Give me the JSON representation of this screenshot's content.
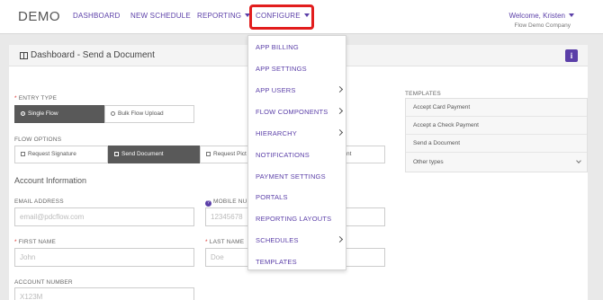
{
  "header": {
    "logo": "DEMO",
    "nav": [
      "DASHBOARD",
      "NEW SCHEDULE",
      "REPORTING",
      "CONFIGURE"
    ],
    "welcome": "Welcome, Kristen",
    "company": "Flow Demo Company"
  },
  "panel": {
    "title": "Dashboard - Send a Document",
    "info_label": "i"
  },
  "entry_type": {
    "label": "ENTRY TYPE",
    "options": [
      "Single Flow",
      "Bulk Flow Upload"
    ],
    "selected": "Single Flow"
  },
  "flow_options": {
    "label": "FLOW OPTIONS",
    "options": [
      "Request Signature",
      "Send Document",
      "Request Pict",
      "nt"
    ],
    "selected": "Send Document"
  },
  "account": {
    "title": "Account Information",
    "email_label": "EMAIL ADDRESS",
    "email_placeholder": "email@pdcflow.com",
    "mobile_label": "MOBILE NUM",
    "mobile_placeholder": "12345678",
    "first_name_label": "FIRST NAME",
    "first_name_placeholder": "John",
    "last_name_label": "LAST NAME",
    "last_name_placeholder": "Doe",
    "account_number_label": "ACCOUNT NUMBER",
    "account_number_placeholder": "X123M"
  },
  "templates": {
    "label": "TEMPLATES",
    "items": [
      "Accept Card Payment",
      "Accept a Check Payment",
      "Send a Document",
      "Other types"
    ]
  },
  "configure_menu": {
    "items": [
      {
        "label": "APP BILLING",
        "submenu": false
      },
      {
        "label": "APP SETTINGS",
        "submenu": false
      },
      {
        "label": "APP USERS",
        "submenu": true
      },
      {
        "label": "FLOW COMPONENTS",
        "submenu": true
      },
      {
        "label": "HIERARCHY",
        "submenu": true
      },
      {
        "label": "NOTIFICATIONS",
        "submenu": false
      },
      {
        "label": "PAYMENT SETTINGS",
        "submenu": false
      },
      {
        "label": "PORTALS",
        "submenu": false
      },
      {
        "label": "REPORTING LAYOUTS",
        "submenu": false
      },
      {
        "label": "SCHEDULES",
        "submenu": true
      },
      {
        "label": "TEMPLATES",
        "submenu": false
      }
    ]
  },
  "colors": {
    "accent": "#5b3fa8",
    "highlight_box": "#e21d1d",
    "selected_button": "#595959",
    "required": "#d9332f"
  }
}
